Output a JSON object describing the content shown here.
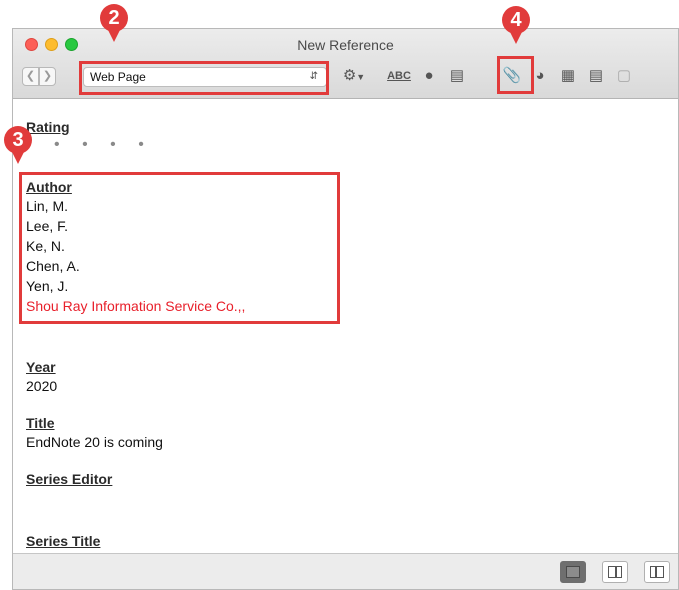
{
  "window": {
    "title": "New Reference"
  },
  "toolbar": {
    "back_icon": "chevron-left-icon",
    "forward_icon": "chevron-right-icon",
    "reference_type": "Web Page",
    "icons": [
      "gear-menu-icon",
      "spellcheck-icon",
      "pushpin-icon",
      "insert-citation-icon",
      "paperclip-attach-icon",
      "find-full-text-icon",
      "word-icon",
      "edit-icon",
      "open-url-icon"
    ],
    "spellcheck_label": "ABC"
  },
  "fields": {
    "rating": {
      "label": "Rating",
      "stars": "• • • • •"
    },
    "author": {
      "label": "Author",
      "names": [
        "Lin, M.",
        "Lee, F.",
        "Ke, N.",
        "Chen, A.",
        "Yen, J.",
        "Shou Ray Information Service Co.,,"
      ]
    },
    "year": {
      "label": "Year",
      "value": "2020"
    },
    "title": {
      "label": "Title",
      "value": "EndNote 20 is coming"
    },
    "series_editor": {
      "label": "Series Editor"
    },
    "series_title": {
      "label": "Series Title"
    }
  },
  "callouts": [
    {
      "number": "2",
      "target": "reference-type"
    },
    {
      "number": "3",
      "target": "author-field"
    },
    {
      "number": "4",
      "target": "attach-file"
    }
  ],
  "colors": {
    "callout": "#e13b3b",
    "author_highlight": "#e8202b"
  }
}
